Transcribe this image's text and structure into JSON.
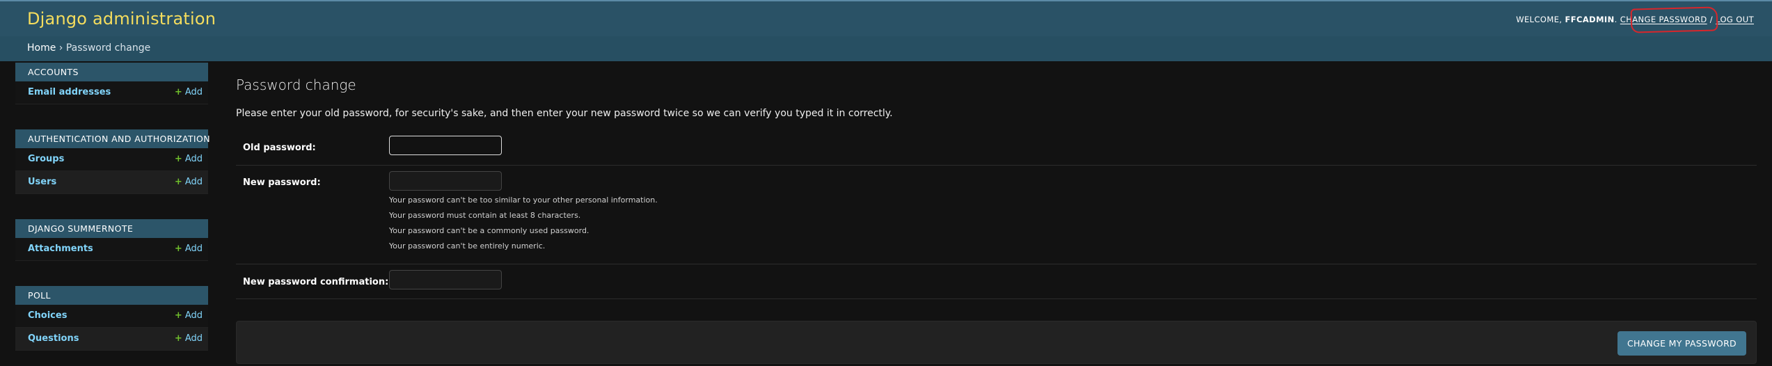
{
  "header": {
    "site_name": "Django administration",
    "welcome": "WELCOME, ",
    "username": "FFCADMIN",
    "username_suffix": ".",
    "change_password": "CHANGE PASSWORD",
    "separator": " / ",
    "log_out": "LOG OUT"
  },
  "breadcrumbs": {
    "home": "Home",
    "separator": " › ",
    "current": "Password change"
  },
  "sidebar": {
    "add_label": "Add",
    "modules": [
      {
        "caption": "ACCOUNTS",
        "models": [
          "Email addresses"
        ]
      },
      {
        "caption": "AUTHENTICATION AND AUTHORIZATION",
        "models": [
          "Groups",
          "Users"
        ]
      },
      {
        "caption": "DJANGO SUMMERNOTE",
        "models": [
          "Attachments"
        ]
      },
      {
        "caption": "POLL",
        "models": [
          "Choices",
          "Questions"
        ]
      }
    ]
  },
  "content": {
    "title": "Password change",
    "intro": "Please enter your old password, for security's sake, and then enter your new password twice so we can verify you typed it in correctly.",
    "fields": {
      "old_password": {
        "label": "Old password:",
        "value": ""
      },
      "new_password": {
        "label": "New password:",
        "value": "",
        "help": [
          "Your password can't be too similar to your other personal information.",
          "Your password must contain at least 8 characters.",
          "Your password can't be a commonly used password.",
          "Your password can't be entirely numeric."
        ]
      },
      "new_password_confirm": {
        "label": "New password confirmation:",
        "value": ""
      }
    },
    "submit_label": "CHANGE MY PASSWORD"
  },
  "colors": {
    "header_bg": "#2a5266",
    "site_name": "#f5dd5d",
    "link": "#81d4fa",
    "add_plus": "#70bf2b",
    "button_bg": "#417690",
    "annotation": "#d8262b"
  },
  "icons": [
    "plus-icon"
  ]
}
